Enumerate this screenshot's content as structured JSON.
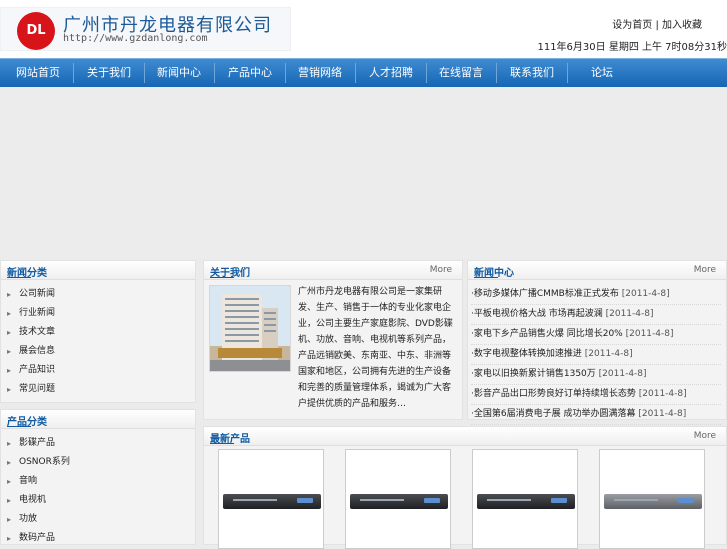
{
  "header": {
    "logo_badge": "DL",
    "company_name": "广州市丹龙电器有限公司",
    "url": "http://www.gzdanlong.com",
    "toplinks": [
      "设为首页",
      "加入收藏"
    ],
    "datetime": "111年6月30日 星期四 上午 7时08分31秒"
  },
  "nav": {
    "items": [
      "网站首页",
      "关于我们",
      "新闻中心",
      "产品中心",
      "营销网络",
      "人才招聘",
      "在线留言",
      "联系我们",
      "论坛"
    ]
  },
  "sidebar": {
    "news_cat": {
      "title": "新闻分类",
      "items": [
        "公司新闻",
        "行业新闻",
        "技术文章",
        "展会信息",
        "产品知识",
        "常见问题"
      ]
    },
    "product_cat": {
      "title": "产品分类",
      "items": [
        "影碟产品",
        "OSNOR系列",
        "音响",
        "电视机",
        "功放",
        "数码产品"
      ]
    }
  },
  "about": {
    "title": "关于我们",
    "more": "More",
    "text": "广州市丹龙电器有限公司是一家集研发、生产、销售于一体的专业化家电企业，公司主要生产家庭影院、DVD影碟机、功放、音响、电视机等系列产品，产品远销欧美、东南亚、中东、非洲等国家和地区，公司拥有先进的生产设备和完善的质量管理体系，竭诚为广大客户提供优质的产品和服务…"
  },
  "news": {
    "title": "新闻中心",
    "more": "More",
    "items": [
      {
        "title": "·移动多媒体广播CMMB标准正式发布",
        "date": "[2011-4-8]"
      },
      {
        "title": "·平板电视价格大战 市场再起波澜",
        "date": "[2011-4-8]"
      },
      {
        "title": "·家电下乡产品销售火爆 同比增长20%",
        "date": "[2011-4-8]"
      },
      {
        "title": "·数字电视整体转换加速推进",
        "date": "[2011-4-8]"
      },
      {
        "title": "·家电以旧换新累计销售1350万",
        "date": "[2011-4-8]"
      },
      {
        "title": "·影音产品出口形势良好订单持续增长态势",
        "date": "[2011-4-8]"
      },
      {
        "title": "·全国第6届消费电子展 成功举办圆满落幕",
        "date": "[2011-4-8]"
      }
    ]
  },
  "products": {
    "title": "最新产品",
    "more": "More",
    "items": [
      {
        "kind": "dvd-player"
      },
      {
        "kind": "dvd-player"
      },
      {
        "kind": "dvd-player"
      },
      {
        "kind": "dvd-player-silver"
      }
    ]
  },
  "colors": {
    "nav_top": "#3f8bd2",
    "nav_bottom": "#1566b4",
    "accent": "#0f5aa2",
    "logo_red": "#d7141a"
  }
}
